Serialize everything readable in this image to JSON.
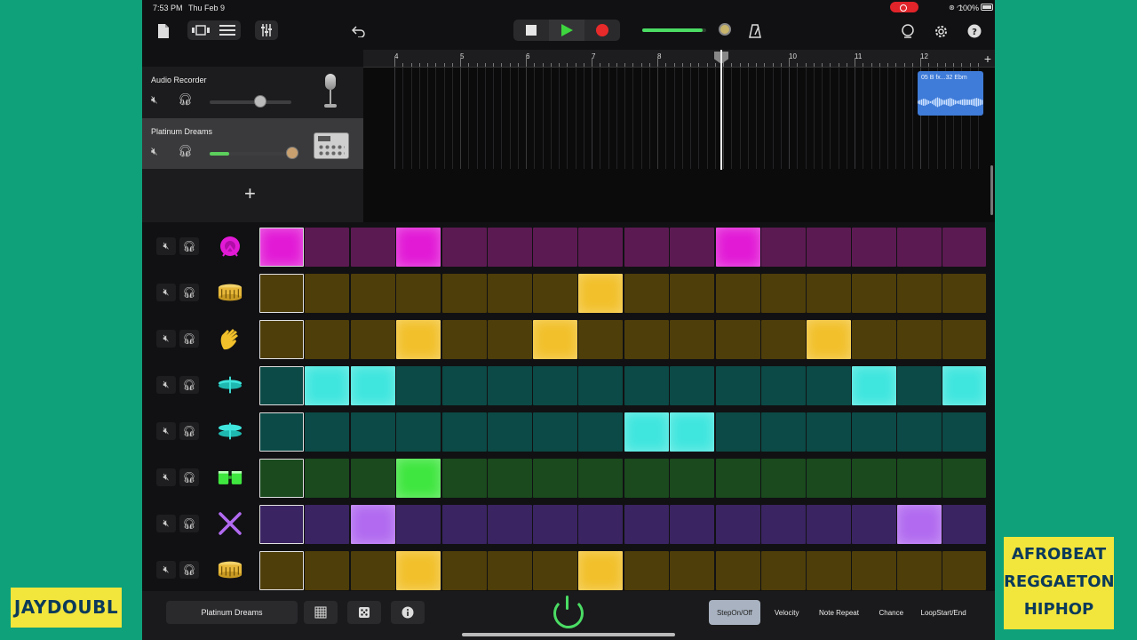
{
  "status": {
    "time": "7:53 PM",
    "date": "Thu Feb 9",
    "battery": "100%"
  },
  "toolbar": {
    "icons": [
      "document-icon",
      "browser-view-icon",
      "tracks-view-icon",
      "mixer-icon",
      "undo-icon",
      "stop-icon",
      "play-icon",
      "record-icon",
      "metronome-icon",
      "loop-browser-icon",
      "settings-icon",
      "help-icon"
    ],
    "master_volume": 0.95
  },
  "tracks": [
    {
      "name": "Audio Recorder",
      "instrument_icon": "microphone-icon",
      "volume": 0.62
    },
    {
      "name": "Platinum Dreams",
      "instrument_icon": "drum-machine-icon",
      "volume": 1.0
    }
  ],
  "timeline": {
    "bars": [
      "4",
      "5",
      "6",
      "7",
      "8",
      "9",
      "10",
      "11",
      "12"
    ],
    "region_name": "05 B fx...32 Ebm"
  },
  "sequencer": {
    "rows": [
      {
        "icon": "kick-drum-icon",
        "color_on": "#e21ad6",
        "color_off": "#5c1a52",
        "steps": [
          1,
          0,
          0,
          1,
          0,
          0,
          0,
          0,
          0,
          0,
          1,
          0,
          0,
          0,
          0,
          0
        ]
      },
      {
        "icon": "snare-drum-icon",
        "color_on": "#f2c02a",
        "color_off": "#4e3e0a",
        "steps": [
          0,
          0,
          0,
          0,
          0,
          0,
          0,
          1,
          0,
          0,
          0,
          0,
          0,
          0,
          0,
          0
        ]
      },
      {
        "icon": "clap-icon",
        "color_on": "#f2c02a",
        "color_off": "#4e3e0a",
        "steps": [
          0,
          0,
          0,
          1,
          0,
          0,
          1,
          0,
          0,
          0,
          0,
          0,
          1,
          0,
          0,
          0
        ]
      },
      {
        "icon": "hihat-closed-icon",
        "color_on": "#3fe6de",
        "color_off": "#0b4a46",
        "steps": [
          0,
          1,
          1,
          0,
          0,
          0,
          0,
          0,
          0,
          0,
          0,
          0,
          0,
          1,
          0,
          1
        ]
      },
      {
        "icon": "hihat-open-icon",
        "color_on": "#3fe6de",
        "color_off": "#0b4a46",
        "steps": [
          0,
          0,
          0,
          0,
          0,
          0,
          0,
          0,
          1,
          1,
          0,
          0,
          0,
          0,
          0,
          0
        ]
      },
      {
        "icon": "bongo-icon",
        "color_on": "#3fe63f",
        "color_off": "#1a4a1e",
        "steps": [
          0,
          0,
          0,
          1,
          0,
          0,
          0,
          0,
          0,
          0,
          0,
          0,
          0,
          0,
          0,
          0
        ]
      },
      {
        "icon": "sticks-icon",
        "color_on": "#b16af0",
        "color_off": "#3a2462",
        "steps": [
          0,
          0,
          1,
          0,
          0,
          0,
          0,
          0,
          0,
          0,
          0,
          0,
          0,
          0,
          1,
          0
        ]
      },
      {
        "icon": "snare-drum-icon",
        "color_on": "#f2c02a",
        "color_off": "#4e3e0a",
        "steps": [
          0,
          0,
          0,
          1,
          0,
          0,
          0,
          1,
          0,
          0,
          0,
          0,
          0,
          0,
          0,
          0
        ]
      }
    ]
  },
  "bottom": {
    "pattern_name": "Platinum Dreams",
    "modes": [
      {
        "line1": "Step",
        "line2": "On/Off",
        "active": true
      },
      {
        "line1": "Velocity",
        "line2": "",
        "active": false
      },
      {
        "line1": "Note Repeat",
        "line2": "",
        "active": false
      },
      {
        "line1": "Chance",
        "line2": "",
        "active": false
      },
      {
        "line1": "Loop",
        "line2": "Start/End",
        "active": false
      }
    ]
  },
  "watermarks": {
    "left": "JAYDOUBL",
    "right": [
      "AFROBEAT",
      "REGGAETON",
      "HIPHOP"
    ]
  }
}
